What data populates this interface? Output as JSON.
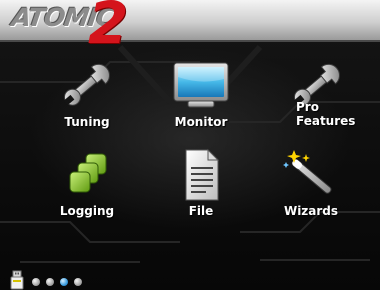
{
  "brand": {
    "name": "ATOMIC",
    "version": "2",
    "logo_colors": {
      "text": "#8c8c8c",
      "accent": "#d4141c"
    }
  },
  "menu": {
    "items": [
      {
        "id": "tuning",
        "label": "Tuning",
        "icon": "wrench-icon"
      },
      {
        "id": "monitor",
        "label": "Monitor",
        "icon": "monitor-icon"
      },
      {
        "id": "pro",
        "label": "Pro\nFeatures",
        "icon": "wrench-icon"
      },
      {
        "id": "logging",
        "label": "Logging",
        "icon": "stacked-squares-icon"
      },
      {
        "id": "file",
        "label": "File",
        "icon": "document-icon"
      },
      {
        "id": "wizards",
        "label": "Wizards",
        "icon": "magic-wand-icon"
      }
    ]
  },
  "footer": {
    "usb_icon": "usb-icon",
    "page_indicator": {
      "count": 4,
      "active_index": 2,
      "active_color": "#3a9de0"
    }
  }
}
